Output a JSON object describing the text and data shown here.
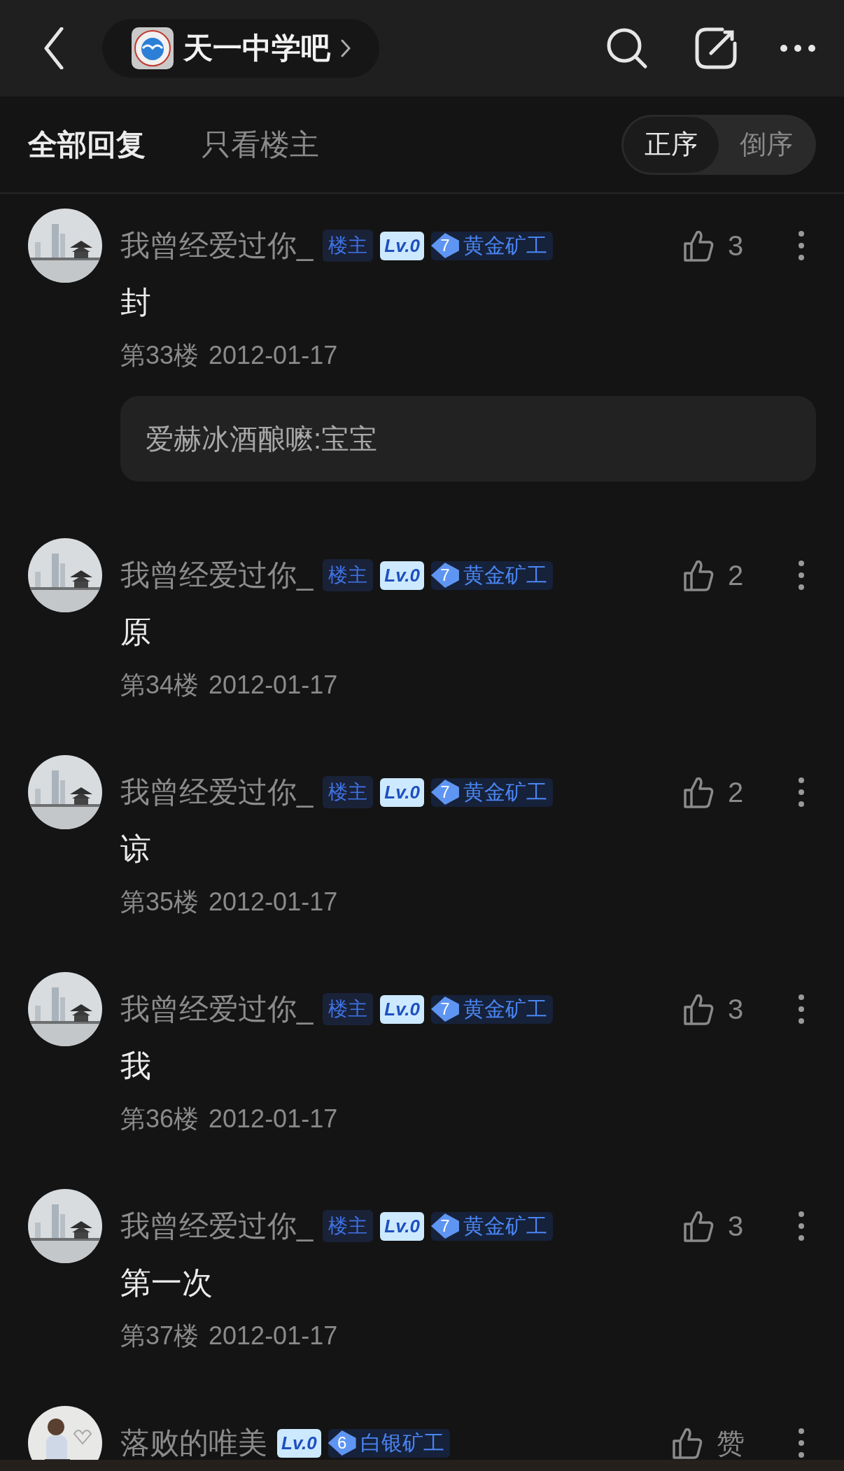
{
  "header": {
    "forum_name": "天一中学吧"
  },
  "tabs": [
    {
      "label": "全部回复",
      "selected": true
    },
    {
      "label": "只看楼主",
      "selected": false
    }
  ],
  "sort": [
    {
      "label": "正序",
      "selected": true
    },
    {
      "label": "倒序",
      "selected": false
    }
  ],
  "posts": [
    {
      "author": "我曾经爱过你_",
      "op_label": "楼主",
      "level": "Lv.0",
      "rank_num": "7",
      "rank": "黄金矿工",
      "likes": "3",
      "content": "封",
      "floor": "第33楼",
      "date": "2012-01-17",
      "quote": "爱赫冰酒酿嚒:宝宝"
    },
    {
      "author": "我曾经爱过你_",
      "op_label": "楼主",
      "level": "Lv.0",
      "rank_num": "7",
      "rank": "黄金矿工",
      "likes": "2",
      "content": "原",
      "floor": "第34楼",
      "date": "2012-01-17"
    },
    {
      "author": "我曾经爱过你_",
      "op_label": "楼主",
      "level": "Lv.0",
      "rank_num": "7",
      "rank": "黄金矿工",
      "likes": "2",
      "content": "谅",
      "floor": "第35楼",
      "date": "2012-01-17"
    },
    {
      "author": "我曾经爱过你_",
      "op_label": "楼主",
      "level": "Lv.0",
      "rank_num": "7",
      "rank": "黄金矿工",
      "likes": "3",
      "content": "我",
      "floor": "第36楼",
      "date": "2012-01-17"
    },
    {
      "author": "我曾经爱过你_",
      "op_label": "楼主",
      "level": "Lv.0",
      "rank_num": "7",
      "rank": "黄金矿工",
      "likes": "3",
      "content": "第一次",
      "floor": "第37楼",
      "date": "2012-01-17"
    },
    {
      "author": "落败的唯美",
      "level": "Lv.0",
      "rank_num": "6",
      "rank": "白银矿工",
      "likes": "赞"
    }
  ]
}
